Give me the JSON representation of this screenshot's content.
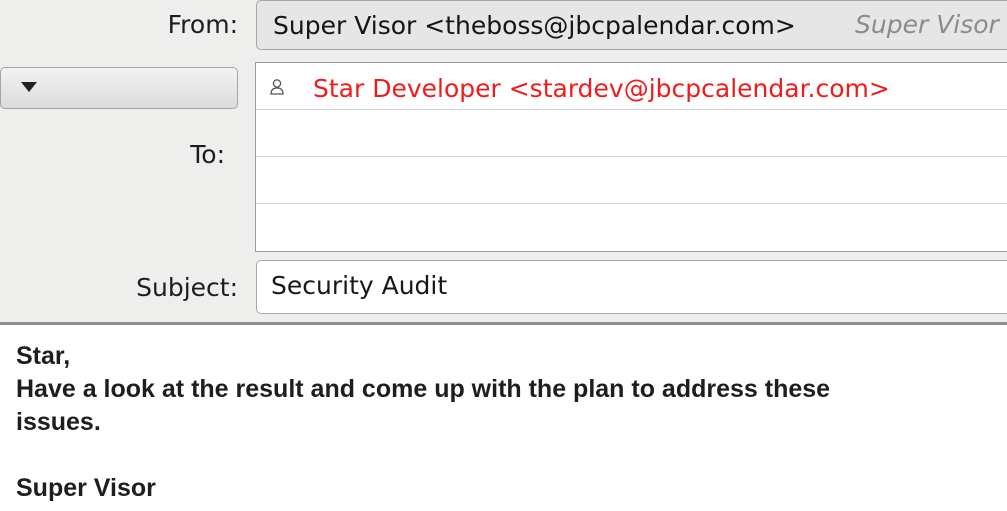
{
  "from": {
    "label": "From:",
    "value": "Super Visor <theboss@jbcpalendar.com>",
    "name_hint": "Super Visor"
  },
  "to": {
    "label": "To:",
    "recipients": [
      "Star Developer <stardev@jbcpcalendar.com>"
    ]
  },
  "subject": {
    "label": "Subject:",
    "value": "Security Audit"
  },
  "body": {
    "lines": [
      "Star,",
      "Have a look at the result and come up with the plan to address these",
      "issues.",
      "",
      "Super Visor"
    ]
  },
  "colors": {
    "recipient": "#ef1c1c",
    "header_bg": "#eeeeec"
  },
  "icons": {
    "recipient": "person-icon",
    "to_dropdown": "chevron-down-icon"
  }
}
